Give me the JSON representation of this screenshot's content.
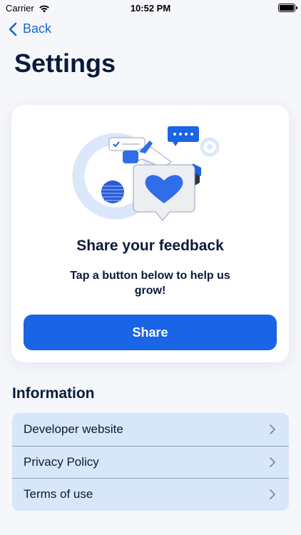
{
  "status_bar": {
    "carrier": "Carrier",
    "time": "10:52 PM"
  },
  "nav": {
    "back_label": "Back"
  },
  "page": {
    "title": "Settings"
  },
  "feedback": {
    "title": "Share your feedback",
    "subtitle": "Tap a button below to help us grow!",
    "button_label": "Share"
  },
  "information": {
    "title": "Information",
    "items": [
      {
        "label": "Developer website"
      },
      {
        "label": "Privacy Policy"
      },
      {
        "label": "Terms of use"
      }
    ]
  },
  "colors": {
    "accent": "#1a64e6",
    "list_bg": "#d8e6f9",
    "title": "#0b1a3a"
  }
}
